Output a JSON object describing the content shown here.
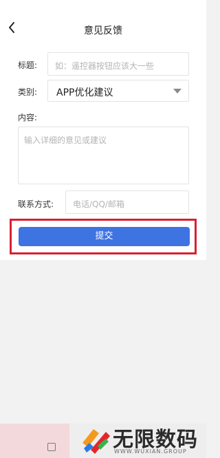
{
  "header": {
    "title": "意见反馈",
    "back_icon": "chevron-left-icon"
  },
  "form": {
    "title_label": "标题:",
    "title_placeholder": "如：遥控器按钮应该大一些",
    "category_label": "类别:",
    "category_value": "APP优化建议",
    "content_label": "内容:",
    "content_placeholder": "输入详细的意见或建议",
    "contact_label": "联系方式:",
    "contact_placeholder": "电话/QQ/邮箱",
    "submit_label": "提交"
  },
  "colors": {
    "primary_button": "#3e73e2",
    "highlight_border": "#d52231"
  },
  "watermark": {
    "name": "无限数码",
    "url": "WWW.WUXIAN.GROUP"
  }
}
